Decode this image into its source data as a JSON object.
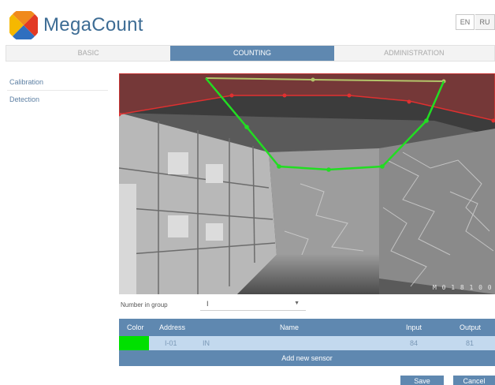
{
  "app": {
    "brand": "MegaCount",
    "languages": [
      "EN",
      "RU"
    ]
  },
  "tabs": [
    {
      "label": "BASIC",
      "active": false
    },
    {
      "label": "COUNTING",
      "active": true
    },
    {
      "label": "ADMINISTRATION",
      "active": false
    }
  ],
  "sidebar": {
    "items": [
      {
        "label": "Calibration"
      },
      {
        "label": "Detection"
      }
    ]
  },
  "camera": {
    "overlay_label": "M 0 1 8  1 0 0"
  },
  "group": {
    "label": "Number in group",
    "value": "I"
  },
  "sensors": {
    "columns": [
      "Color",
      "Address",
      "Name",
      "Input",
      "Output"
    ],
    "rows": [
      {
        "color": "#00e000",
        "address": "I-01",
        "name": "IN",
        "input": "84",
        "output": "81"
      }
    ],
    "add_label": "Add new sensor"
  },
  "actions": {
    "save_label": "Save",
    "cancel_label": "Cancel"
  },
  "colors": {
    "accent": "#5f88b0",
    "zone_red": "#e03030",
    "zone_green": "#22dd22"
  }
}
